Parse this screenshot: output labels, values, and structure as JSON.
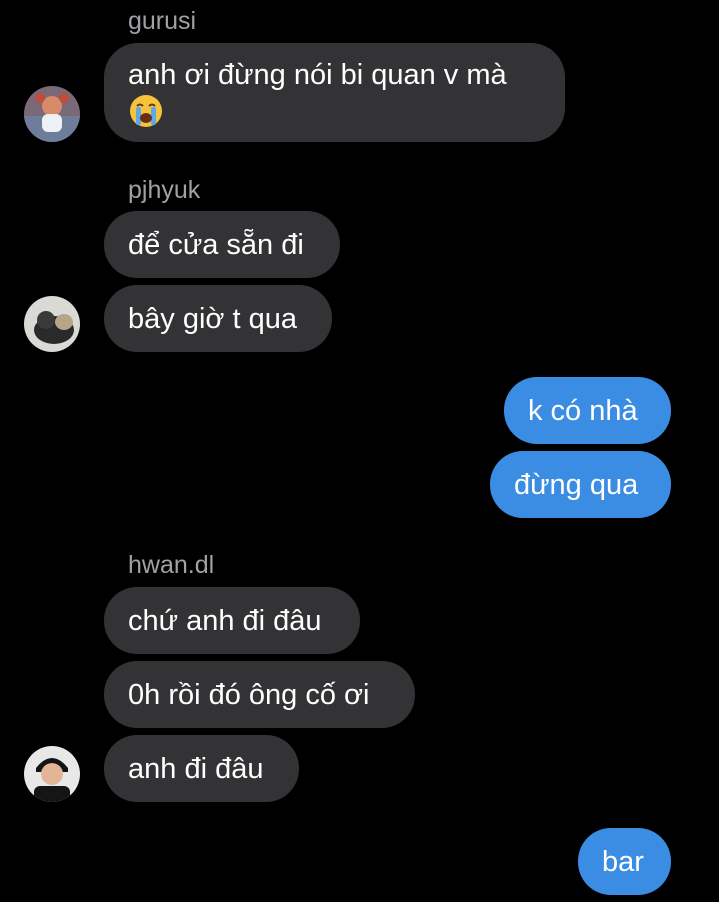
{
  "thread": [
    {
      "sender": "gurusi",
      "messages": [
        {
          "line1": "anh ơi đừng nói bi quan v mà",
          "emoji": "loudly-crying-face-icon"
        }
      ]
    },
    {
      "sender": "pjhyuk",
      "messages": [
        {
          "text": "để cửa sẵn đi"
        },
        {
          "text": "bây giờ t qua"
        }
      ]
    },
    {
      "sender": "me",
      "messages": [
        {
          "text": "k có nhà"
        },
        {
          "text": "đừng qua"
        }
      ]
    },
    {
      "sender": "hwan.dl",
      "messages": [
        {
          "text": "chứ anh đi đâu"
        },
        {
          "text": "0h rồi đó ông cố ơi"
        },
        {
          "text": "anh đi đâu"
        }
      ]
    },
    {
      "sender": "me",
      "messages": [
        {
          "text": "bar"
        }
      ]
    }
  ],
  "colors": {
    "background": "#000000",
    "incoming_bubble": "#333335",
    "outgoing_bubble": "#3b8de3",
    "sender_name": "#a0a0a5"
  }
}
